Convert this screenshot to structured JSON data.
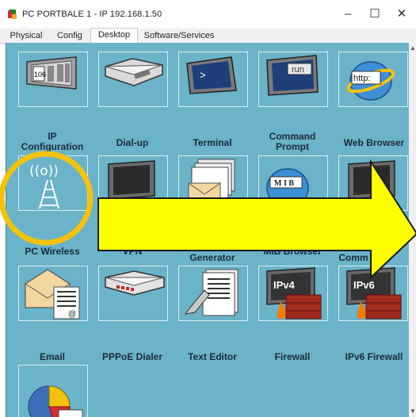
{
  "window": {
    "title": "PC PORTBALE 1 - IP 192.168.1.50",
    "minimize_glyph": "–",
    "maximize_glyph": "☐",
    "close_glyph": "✕"
  },
  "tabs": [
    {
      "label": "Physical",
      "active": false
    },
    {
      "label": "Config",
      "active": false
    },
    {
      "label": "Desktop",
      "active": true
    },
    {
      "label": "Software/Services",
      "active": false
    }
  ],
  "desktop": {
    "background": "#6ab3c8",
    "apps": [
      {
        "label_line1": "IP",
        "label_line2": "Configuration",
        "icon": "ip-configuration-icon",
        "screen_text": "106"
      },
      {
        "label_line1": "Dial-up",
        "label_line2": "",
        "icon": "dial-up-icon"
      },
      {
        "label_line1": "Terminal",
        "label_line2": "",
        "icon": "terminal-icon",
        "screen_text": ">"
      },
      {
        "label_line1": "Command",
        "label_line2": "Prompt",
        "icon": "command-prompt-icon",
        "screen_text": "run"
      },
      {
        "label_line1": "Web Browser",
        "label_line2": "",
        "icon": "web-browser-icon",
        "screen_text": "http:"
      },
      {
        "label_line1": "PC Wireless",
        "label_line2": "",
        "icon": "pc-wireless-icon",
        "glyph": "((o))"
      },
      {
        "label_line1": "VPN",
        "label_line2": "",
        "icon": "vpn-icon"
      },
      {
        "label_line1": "Generator",
        "label_line2": "",
        "icon": "traffic-generator-icon"
      },
      {
        "label_line1": "MIB Browser",
        "label_line2": "",
        "icon": "mib-browser-icon",
        "screen_text": "M I B"
      },
      {
        "label_line1": "Comm",
        "label_line2": "",
        "icon": "communication-icon"
      },
      {
        "label_line1": "Email",
        "label_line2": "",
        "icon": "email-icon",
        "screen_text": "@"
      },
      {
        "label_line1": "PPPoE Dialer",
        "label_line2": "",
        "icon": "pppoe-dialer-icon"
      },
      {
        "label_line1": "Text Editor",
        "label_line2": "",
        "icon": "text-editor-icon"
      },
      {
        "label_line1": "Firewall",
        "label_line2": "",
        "icon": "firewall-icon",
        "screen_text": "IPv4"
      },
      {
        "label_line1": "IPv6 Firewall",
        "label_line2": "",
        "icon": "ipv6-firewall-icon",
        "screen_text": "IPv6"
      },
      {
        "label_line1": "",
        "label_line2": "",
        "icon": "netflow-chart-icon"
      }
    ]
  },
  "annotation": {
    "highlight_color": "#f4c20d",
    "arrow_color": "#ffff00",
    "arrow_outline": "#1a1a1a"
  }
}
